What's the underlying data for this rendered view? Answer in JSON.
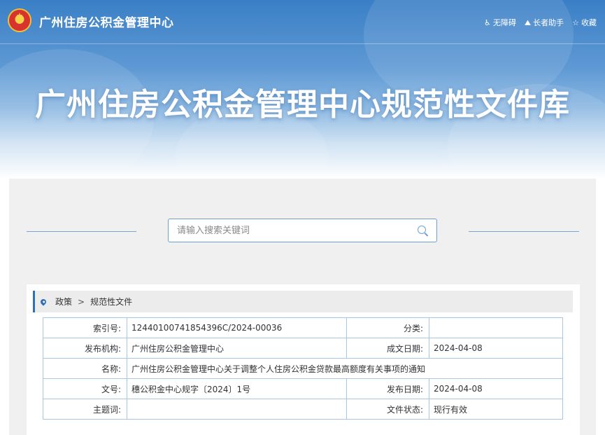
{
  "header": {
    "site_name": "广州住房公积金管理中心",
    "links": [
      {
        "label": "无障碍",
        "icon": "accessibility-icon"
      },
      {
        "label": "长者助手",
        "icon": "elder-assist-icon"
      },
      {
        "label": "收藏",
        "icon": "star-icon"
      }
    ]
  },
  "hero": {
    "title": "广州住房公积金管理中心规范性文件库"
  },
  "search": {
    "placeholder": "请输入搜索关键词",
    "value": ""
  },
  "breadcrumb": {
    "items": [
      "政策",
      "规范性文件"
    ],
    "separator": ">"
  },
  "document": {
    "index_no_label": "索引号:",
    "index_no": "12440100741854396C/2024-00036",
    "category_label": "分类:",
    "category": "",
    "issuer_label": "发布机构:",
    "issuer": "广州住房公积金管理中心",
    "written_date_label": "成文日期:",
    "written_date": "2024-04-08",
    "name_label": "名称:",
    "name": "广州住房公积金管理中心关于调整个人住房公积金贷款最高额度有关事项的通知",
    "doc_no_label": "文号:",
    "doc_no": "穗公积金中心规字〔2024〕1号",
    "publish_date_label": "发布日期:",
    "publish_date": "2024-04-08",
    "keywords_label": "主题词:",
    "keywords": "",
    "status_label": "文件状态:",
    "status": "现行有效"
  },
  "colors": {
    "accent": "#2f6fb5",
    "border": "#a8c6e6",
    "panel_bg": "#f0f0f0"
  }
}
